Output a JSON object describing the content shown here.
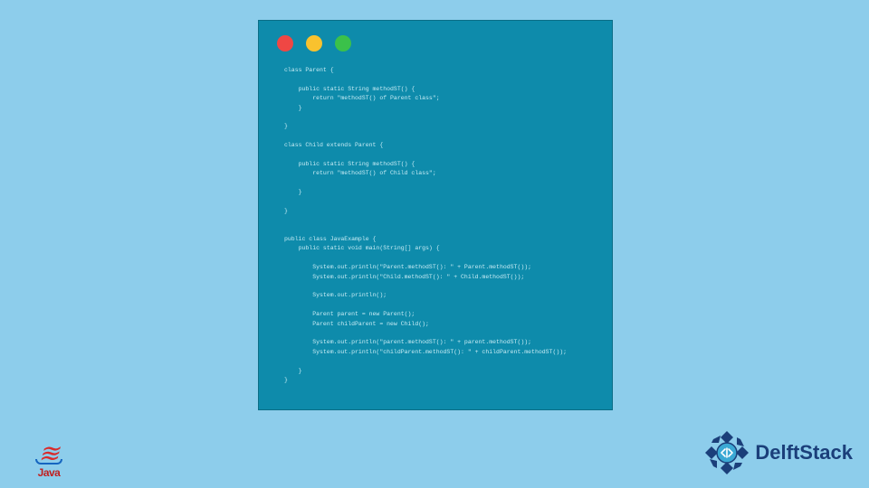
{
  "code_lines": "class Parent {\n\n    public static String methodST() {\n        return \"methodST() of Parent class\";\n    }\n\n}\n\nclass Child extends Parent {\n\n    public static String methodST() {\n        return \"methodST() of Child class\";\n\n    }\n\n}\n\n\npublic class JavaExample {\n    public static void main(String[] args) {\n\n        System.out.println(\"Parent.methodST(): \" + Parent.methodST());\n        System.out.println(\"Child.methodST(): \" + Child.methodST());\n\n        System.out.println();\n\n        Parent parent = new Parent();\n        Parent childParent = new Child();\n\n        System.out.println(\"parent.methodST(): \" + parent.methodST());\n        System.out.println(\"childParent.methodST(): \" + childParent.methodST());\n\n    }\n}",
  "java_label": "Java",
  "delft_label": "DelftStack"
}
